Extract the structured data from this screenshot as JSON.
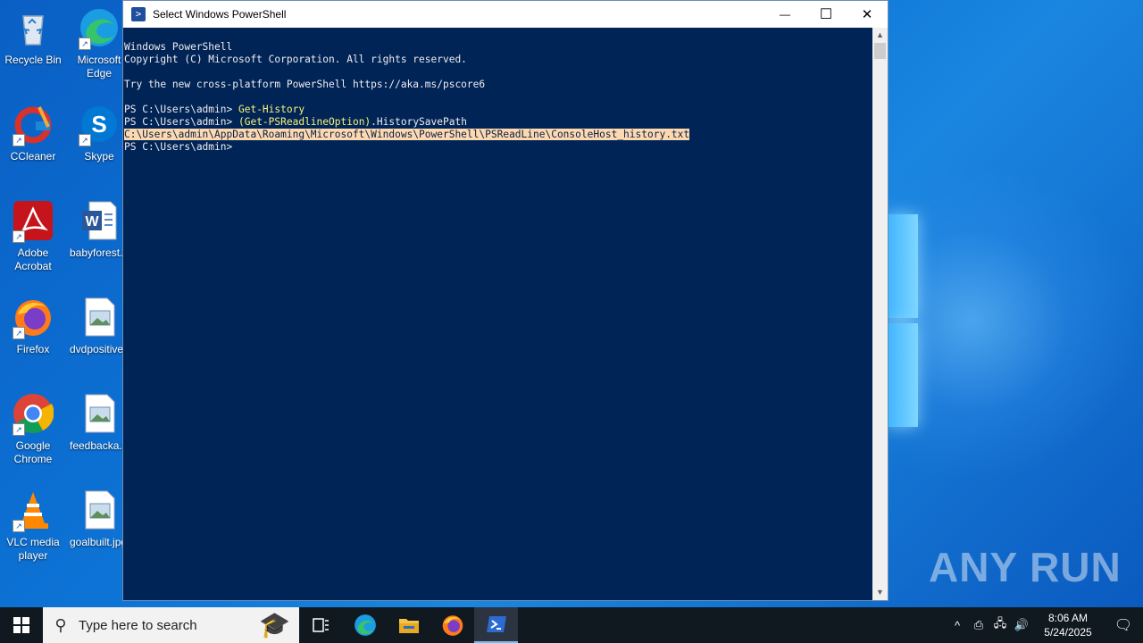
{
  "desktop": {
    "icons": [
      {
        "label": "Recycle Bin"
      },
      {
        "label": "Microsoft Edge"
      },
      {
        "label": "CCleaner"
      },
      {
        "label": "Skype"
      },
      {
        "label": "Adobe Acrobat"
      },
      {
        "label": "babyforest.rtf"
      },
      {
        "label": "Firefox"
      },
      {
        "label": "dvdpositive.png"
      },
      {
        "label": "Google Chrome"
      },
      {
        "label": "feedbacka.png"
      },
      {
        "label": "VLC media player"
      },
      {
        "label": "goalbuilt.jpg"
      }
    ],
    "watermark": "ANY RUN"
  },
  "window": {
    "title": "Select Windows PowerShell",
    "icon": "powershell-icon",
    "controls": {
      "minimize": "—",
      "maximize": "☐",
      "close": "✕"
    }
  },
  "console": {
    "line1": "Windows PowerShell",
    "line2": "Copyright (C) Microsoft Corporation. All rights reserved.",
    "line3": "",
    "line4": "Try the new cross-platform PowerShell https://aka.ms/pscore6",
    "line5": "",
    "prompt": "PS C:\\Users\\admin> ",
    "cmd1": "Get-History",
    "cmd2_part1": "(Get-PSReadlineOption)",
    "cmd2_part2": ".HistorySavePath",
    "output_path": "C:\\Users\\admin\\AppData\\Roaming\\Microsoft\\Windows\\PowerShell\\PSReadLine\\ConsoleHost_history.txt",
    "final_prompt": "PS C:\\Users\\admin>"
  },
  "taskbar": {
    "search_placeholder": "Type here to search",
    "clock_time": "8:06 AM",
    "clock_date": "5/24/2025",
    "colors": {
      "taskbar_bg": "#101820",
      "console_bg": "#012456",
      "accent": "#76b9ed"
    }
  }
}
